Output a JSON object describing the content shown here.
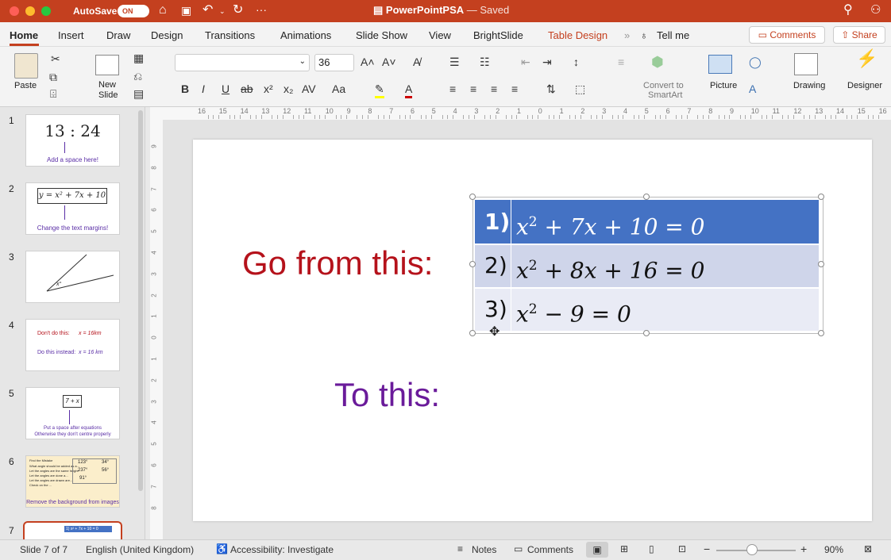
{
  "titlebar": {
    "autosave_label": "AutoSave",
    "autosave_toggle": "ON",
    "title": "PowerPointPSA",
    "saved": " — Saved"
  },
  "tabs": [
    "Home",
    "Insert",
    "Draw",
    "Design",
    "Transitions",
    "Animations",
    "Slide Show",
    "View",
    "BrightSlide",
    "Table Design",
    "Tell me"
  ],
  "share": {
    "comments": "Comments",
    "share": "Share"
  },
  "ribbon": {
    "paste": "Paste",
    "new_slide_1": "New",
    "new_slide_2": "Slide",
    "font_size": "36",
    "convert_1": "Convert to",
    "convert_2": "SmartArt",
    "picture": "Picture",
    "drawing": "Drawing",
    "designer": "Designer"
  },
  "ruler_h": [
    "16",
    "15",
    "14",
    "13",
    "12",
    "11",
    "10",
    "9",
    "8",
    "7",
    "6",
    "5",
    "4",
    "3",
    "2",
    "1",
    "0",
    "1",
    "2",
    "3",
    "4",
    "5",
    "6",
    "7",
    "8",
    "9",
    "10",
    "11",
    "12",
    "13",
    "14",
    "15",
    "16"
  ],
  "ruler_v": [
    "9",
    "8",
    "7",
    "6",
    "5",
    "4",
    "3",
    "2",
    "1",
    "0",
    "1",
    "2",
    "3",
    "4",
    "5",
    "6",
    "7",
    "8"
  ],
  "slides": [
    {
      "num": "1",
      "big": "13 : 24",
      "caption": "Add a space here!"
    },
    {
      "num": "2",
      "eq": "y = x² + 7x + 10",
      "caption": "Change the text margins!"
    },
    {
      "num": "3",
      "angle": "x°"
    },
    {
      "num": "4",
      "l1": "Don't do this:",
      "v1": "x = 16km",
      "l2": "Do this instead:",
      "v2": "x = 16 km"
    },
    {
      "num": "5",
      "box": "7 + x",
      "cap1": "Put a space after equations",
      "cap2": "Otherwise they don't centre properly"
    },
    {
      "num": "6",
      "title": "Find the Mistake",
      "note1": "What angle should be added as a...",
      "b1": "Let the angles are the same height",
      "b2": "Let the angles are done a...",
      "b3": "Let the angles are drawn are...",
      "b4": "Check on the ...",
      "c1": "123°",
      "c2": "34°",
      "c3": "237°",
      "c4": "56°",
      "c5": "91°",
      "caption": "Remove the background from images"
    },
    {
      "num": "7",
      "mini": "1) x² + 7x + 10 = 0"
    }
  ],
  "slide": {
    "go_from": "Go from this:",
    "to_this": "To this:",
    "rows": [
      {
        "num": "1)",
        "pre": "x",
        "sup": "2",
        "post": " + 7x + 10 = 0"
      },
      {
        "num": "2)",
        "pre": "x",
        "sup": "2",
        "post": " + 8x + 16 = 0"
      },
      {
        "num": "3)",
        "pre": "x",
        "sup": "2",
        "post": " − 9 = 0"
      }
    ]
  },
  "status": {
    "slide": "Slide 7 of 7",
    "lang": "English (United Kingdom)",
    "access": "Accessibility: Investigate",
    "notes": "Notes",
    "comments": "Comments",
    "zoom": "90%"
  },
  "colors": {
    "titlebar": "#c4401f",
    "go_from": "#b5121b",
    "to_this": "#6a1b9a",
    "row_header": "#4472c4",
    "row_alt": "#cfd5ea",
    "row_light": "#e9ebf5"
  }
}
